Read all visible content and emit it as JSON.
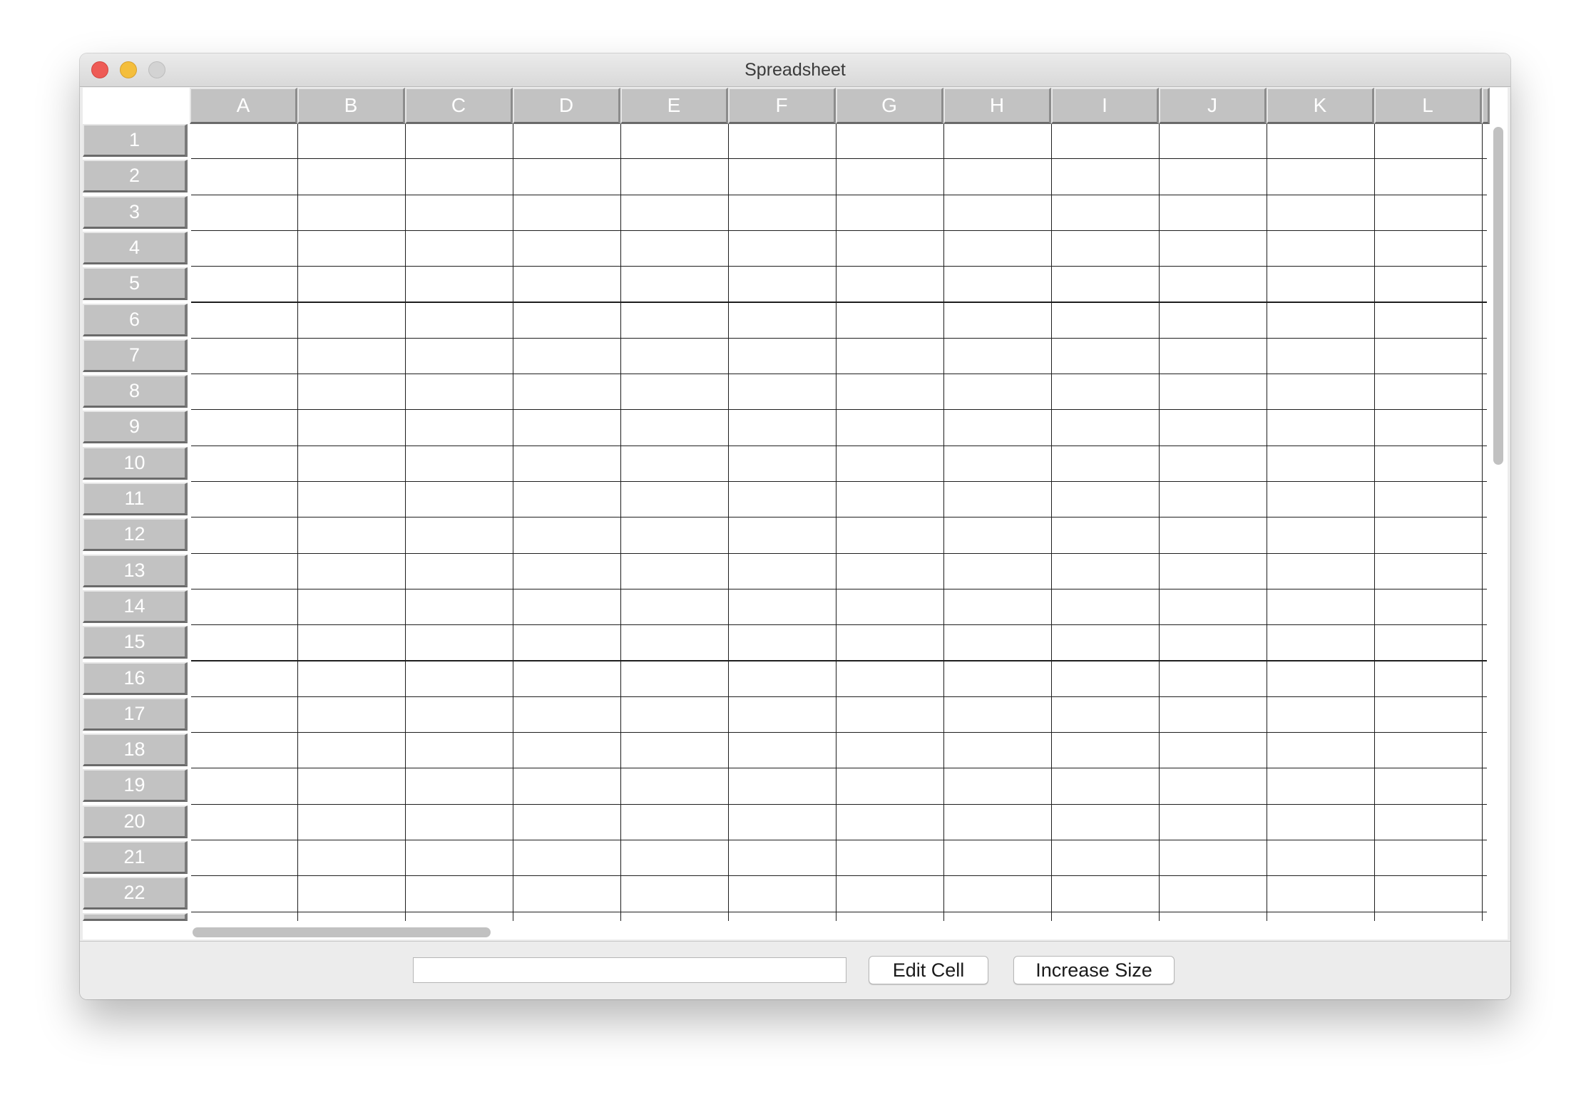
{
  "window": {
    "title": "Spreadsheet"
  },
  "columns": [
    "A",
    "B",
    "C",
    "D",
    "E",
    "F",
    "G",
    "H",
    "I",
    "J",
    "K",
    "L"
  ],
  "rows": [
    "1",
    "2",
    "3",
    "4",
    "5",
    "6",
    "7",
    "8",
    "9",
    "10",
    "11",
    "12",
    "13",
    "14",
    "15",
    "16",
    "17",
    "18",
    "19",
    "20",
    "21",
    "22"
  ],
  "controls": {
    "cell_input_value": "",
    "edit_cell_label": "Edit Cell",
    "increase_size_label": "Increase Size"
  },
  "colors": {
    "header_bg": "#c2c2c2",
    "header_text": "#ffffff",
    "grid_line": "#1e1e1e",
    "close": "#ee5b56",
    "minimize": "#f4be3c",
    "maximize": "#d3d3d3"
  }
}
